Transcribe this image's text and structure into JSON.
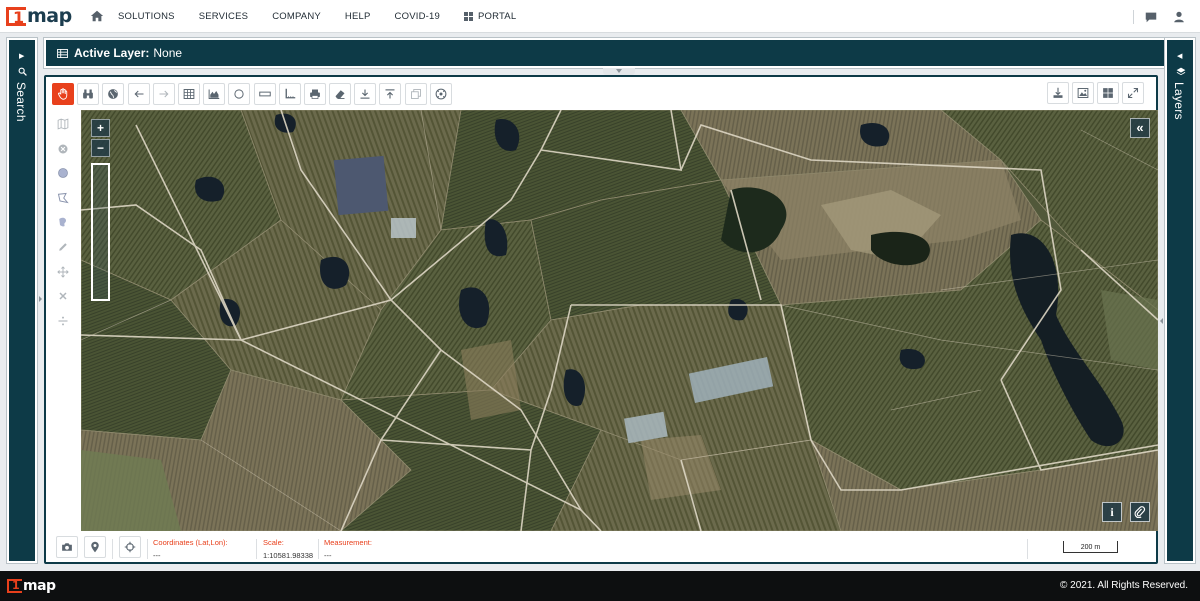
{
  "header": {
    "logo_text": "map",
    "logo_mark": "1",
    "nav": [
      "SOLUTIONS",
      "SERVICES",
      "COMPANY",
      "HELP",
      "COVID-19"
    ],
    "portal": "PORTAL",
    "icons": [
      "home-icon",
      "portal-grid-icon",
      "chat-icon",
      "user-icon"
    ]
  },
  "sidebars": {
    "left": {
      "label": "Search",
      "icon": "search-icon"
    },
    "right": {
      "label": "Layers",
      "icon": "layers-icon"
    }
  },
  "active_layer": {
    "label": "Active Layer:",
    "value": "None"
  },
  "toolbar": {
    "left_tools": [
      "pan-hand-icon",
      "binoculars-icon",
      "globe-icon",
      "arrow-left-icon",
      "arrow-right-icon",
      "grid-icon",
      "area-chart-icon",
      "circle-icon",
      "ruler-icon",
      "corner-measure-icon",
      "print-icon",
      "eraser-icon",
      "download-icon",
      "upload-icon",
      "layers-stack-icon",
      "gauge-icon"
    ],
    "right_tools": [
      "export-icon",
      "image-icon",
      "layout-icon",
      "fullscreen-icon"
    ]
  },
  "side_tools": [
    "map-icon",
    "close-circle-icon",
    "circle-draw-icon",
    "polygon-draw-icon",
    "freehand-draw-icon",
    "pencil-icon",
    "move-icon",
    "delete-x-icon",
    "divide-icon"
  ],
  "map": {
    "zoom_in": "+",
    "zoom_out": "−",
    "collapse": "«",
    "info": "i"
  },
  "status": {
    "coordinates": {
      "label": "Coordinates (Lat,Lon):",
      "value": "---"
    },
    "scale": {
      "label": "Scale:",
      "value": "1:10581.98338"
    },
    "measurement": {
      "label": "Measurement:",
      "value": "---"
    },
    "scalebar": "200 m"
  },
  "footer": {
    "logo_text": "map",
    "logo_mark": "1",
    "copyright": "© 2021. All Rights Reserved."
  },
  "colors": {
    "accent": "#e8401c",
    "panel": "#0d3a47",
    "footer": "#0d0f10"
  }
}
